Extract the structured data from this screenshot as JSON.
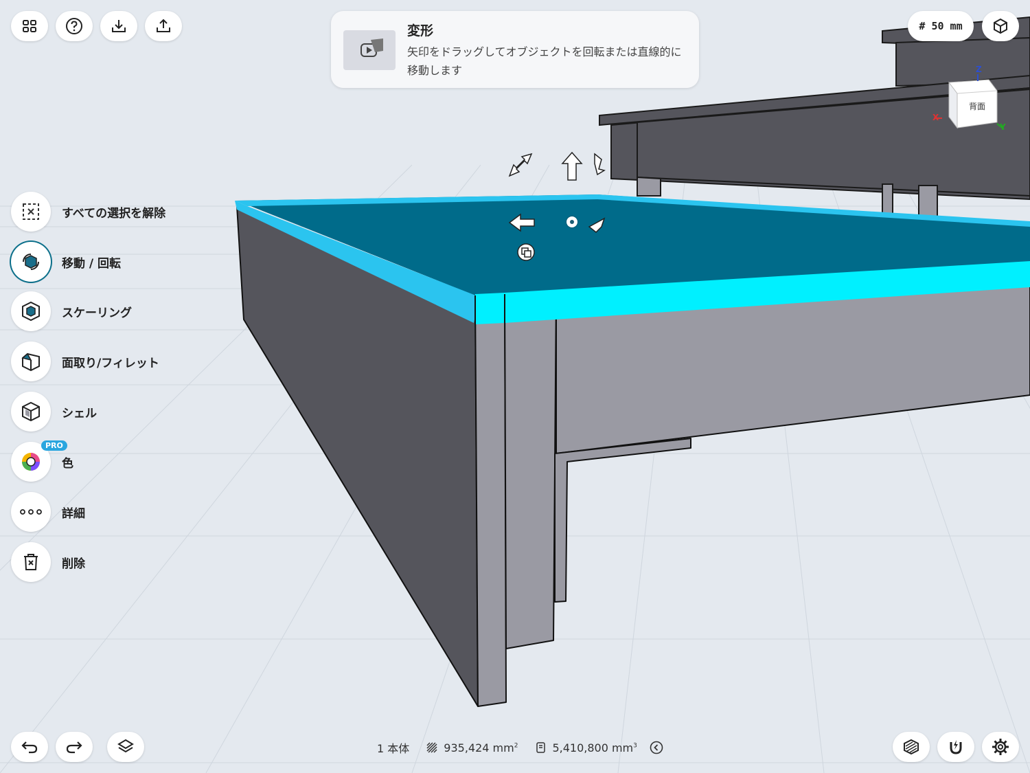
{
  "tooltip": {
    "title": "変形",
    "body": "矢印をドラッグしてオブジェクトを回転または直線的に移動します"
  },
  "grid_pill": "# 50 mm",
  "view_cube": {
    "face_label": "背面",
    "axes": {
      "z": "Z",
      "x": "X",
      "y": "Y"
    }
  },
  "tools": [
    {
      "label": "すべての選択を解除",
      "icon": "deselect-icon"
    },
    {
      "label": "移動 / 回転",
      "icon": "move-rotate-icon",
      "active": true
    },
    {
      "label": "スケーリング",
      "icon": "scale-icon"
    },
    {
      "label": "面取り/フィレット",
      "icon": "chamfer-icon"
    },
    {
      "label": "シェル",
      "icon": "shell-icon"
    },
    {
      "label": "色",
      "icon": "color-icon",
      "badge": "PRO"
    },
    {
      "label": "詳細",
      "icon": "more-icon"
    },
    {
      "label": "削除",
      "icon": "delete-icon"
    }
  ],
  "status": {
    "bodies": "1 本体",
    "area": "935,424 mm",
    "area_unit_exp": "2",
    "volume": "5,410,800 mm",
    "volume_unit_exp": "3"
  },
  "colors": {
    "accent": "#00e5ff",
    "selected_face": "#006b8a",
    "dark_body": "#55555c",
    "light_body": "#9a9aa3"
  }
}
